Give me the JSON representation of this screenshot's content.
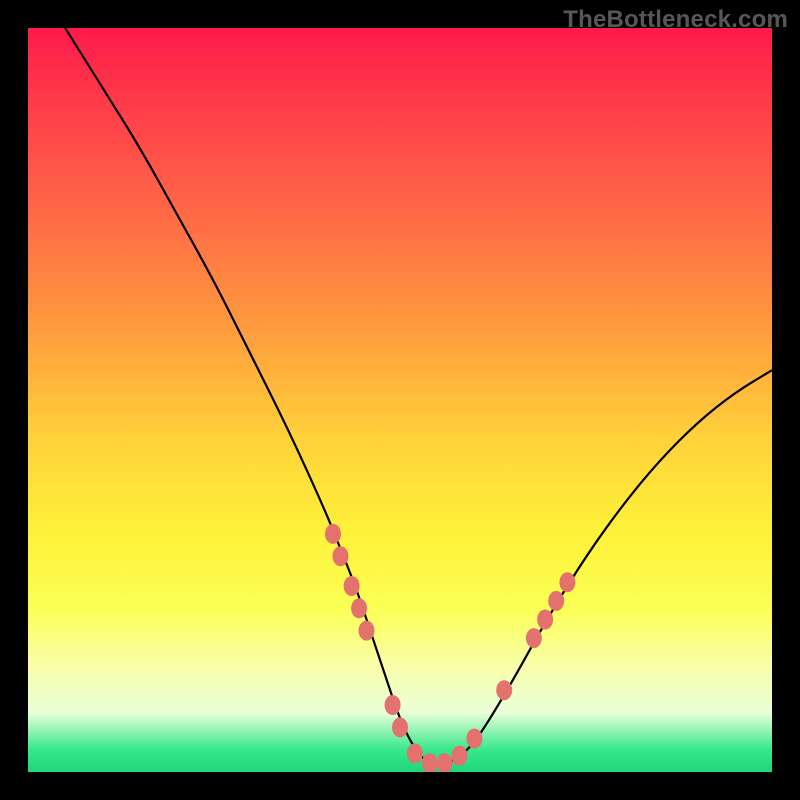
{
  "watermark": "TheBottleneck.com",
  "colors": {
    "curve": "#000000",
    "marker_fill": "#e3726f",
    "marker_stroke": "#d05a57",
    "gradient_top": "#ff1a4b",
    "gradient_bottom": "#1fd67b"
  },
  "chart_data": {
    "type": "line",
    "title": "",
    "xlabel": "",
    "ylabel": "",
    "xlim": [
      0,
      100
    ],
    "ylim": [
      0,
      100
    ],
    "grid": false,
    "legend": false,
    "x": [
      0,
      5,
      10,
      15,
      20,
      25,
      30,
      35,
      40,
      42,
      44,
      46,
      48,
      50,
      52,
      54,
      56,
      58,
      60,
      62,
      65,
      70,
      75,
      80,
      85,
      90,
      95,
      100
    ],
    "values": [
      108,
      100,
      92,
      84,
      75,
      66,
      56,
      46,
      35,
      30,
      25,
      19,
      13,
      7,
      3,
      1,
      1,
      2,
      4,
      7,
      12,
      21,
      29,
      36,
      42,
      47,
      51,
      54
    ],
    "markers": [
      {
        "x": 41,
        "y": 32
      },
      {
        "x": 42,
        "y": 29
      },
      {
        "x": 43.5,
        "y": 25
      },
      {
        "x": 44.5,
        "y": 22
      },
      {
        "x": 45.5,
        "y": 19
      },
      {
        "x": 49,
        "y": 9
      },
      {
        "x": 50,
        "y": 6
      },
      {
        "x": 52,
        "y": 2.5
      },
      {
        "x": 54,
        "y": 1.2
      },
      {
        "x": 56,
        "y": 1.2
      },
      {
        "x": 58,
        "y": 2.2
      },
      {
        "x": 60,
        "y": 4.5
      },
      {
        "x": 64,
        "y": 11
      },
      {
        "x": 68,
        "y": 18
      },
      {
        "x": 69.5,
        "y": 20.5
      },
      {
        "x": 71,
        "y": 23
      },
      {
        "x": 72.5,
        "y": 25.5
      }
    ],
    "marker_radius": 8
  }
}
